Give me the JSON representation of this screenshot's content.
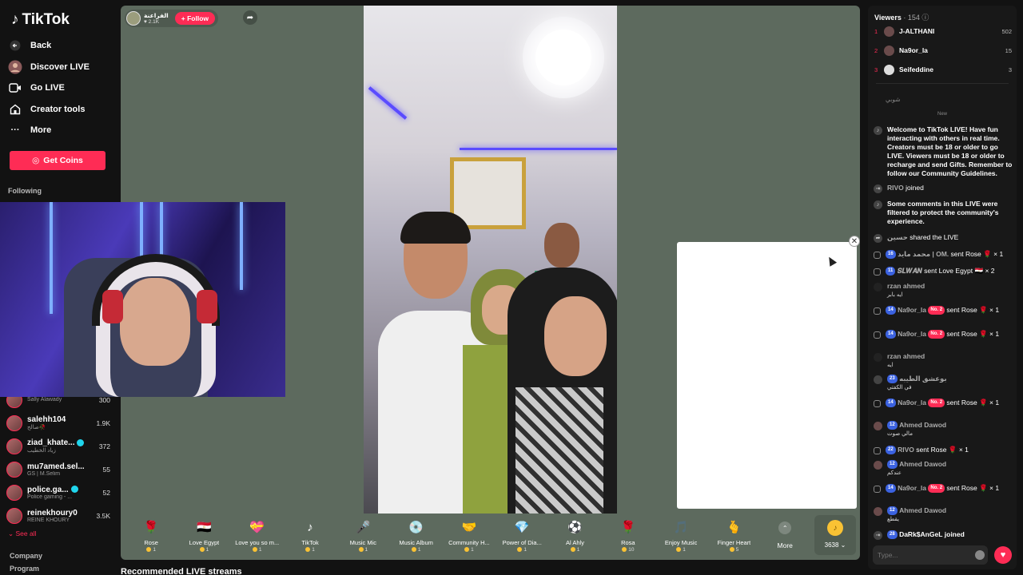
{
  "sidebar": {
    "logo": "TikTok",
    "nav": [
      {
        "label": "Back",
        "icon": "arrow-left-icon"
      },
      {
        "label": "Discover LIVE",
        "icon": "avatar-icon"
      },
      {
        "label": "Go LIVE",
        "icon": "camera-icon"
      },
      {
        "label": "Creator tools",
        "icon": "home-icon"
      },
      {
        "label": "More",
        "icon": "ellipsis-icon"
      }
    ],
    "get_coins": "Get Coins",
    "following_label": "Following",
    "following": [
      {
        "name": "",
        "sub": "Sally Alawady",
        "count": "300"
      },
      {
        "name": "salehh104",
        "sub": "صالح🥀",
        "count": "1.9K"
      },
      {
        "name": "ziad_khate...",
        "sub": "زياد الخطيب",
        "count": "372",
        "verified": true
      },
      {
        "name": "mu7amed.sel...",
        "sub": "GS | M.Selim",
        "count": "55"
      },
      {
        "name": "police.ga...",
        "sub": "Police gaming - ...",
        "count": "52",
        "verified": true
      },
      {
        "name": "reinekhoury0",
        "sub": "REINE KHOURY",
        "count": "3.5K"
      }
    ],
    "see_all": "See all",
    "footer": [
      "Company",
      "Program"
    ]
  },
  "stage": {
    "host_name": "الفراعنة",
    "host_likes": "2.1K",
    "follow_label": "+ Follow"
  },
  "gifts": [
    {
      "name": "Rose",
      "price": "1",
      "icon": "🌹"
    },
    {
      "name": "Love Egypt",
      "price": "1",
      "icon": "🇪🇬"
    },
    {
      "name": "Love you so m...",
      "price": "1",
      "icon": "💝"
    },
    {
      "name": "TikTok",
      "price": "1",
      "icon": "♪"
    },
    {
      "name": "Music Mic",
      "price": "1",
      "icon": "🎤"
    },
    {
      "name": "Music Album",
      "price": "1",
      "icon": "💿"
    },
    {
      "name": "Community H...",
      "price": "1",
      "icon": "🤝"
    },
    {
      "name": "Power of Dia...",
      "price": "1",
      "icon": "💎"
    },
    {
      "name": "Al Ahly",
      "price": "1",
      "icon": "⚽"
    },
    {
      "name": "Rosa",
      "price": "10",
      "icon": "🌹"
    },
    {
      "name": "Enjoy Music",
      "price": "1",
      "icon": "🎵"
    },
    {
      "name": "Finger Heart",
      "price": "5",
      "icon": "🫰"
    }
  ],
  "more_label": "More",
  "coin_balance": "3638",
  "recommended_title": "Recommended LIVE streams",
  "chat": {
    "viewers_label": "Viewers",
    "viewers_count": "· 154",
    "top_viewers": [
      {
        "rank": "1",
        "name": "J-ALTHANI",
        "score": "502"
      },
      {
        "rank": "2",
        "name": "Na9or_la",
        "score": "15"
      },
      {
        "rank": "3",
        "name": "Seifeddine",
        "score": "3"
      }
    ],
    "muted_msg": "شوبي",
    "new_divider": "New",
    "messages": [
      {
        "type": "sys",
        "text": "Welcome to TikTok LIVE! Have fun interacting with others in real time. Creators must be 18 or older to go LIVE. Viewers must be 18 or older to recharge and send Gifts. Remember to follow our Community Guidelines."
      },
      {
        "type": "join",
        "user": "RIVO",
        "text": "joined"
      },
      {
        "type": "sys",
        "text": "Some comments in this LIVE were filtered to protect the community's experience."
      },
      {
        "type": "share",
        "user": "حسين",
        "text": "shared the LIVE"
      },
      {
        "type": "gift",
        "level": "16",
        "user": "محمد مايد | OM.",
        "text": "sent Rose",
        "gift": "🌹",
        "qty": "× 1"
      },
      {
        "type": "gift",
        "level": "11",
        "user": "𝑺𝑳𝑾𝑨𝑵",
        "text": "sent Love Egypt",
        "gift": "🇪🇬",
        "qty": "× 2"
      },
      {
        "type": "comment",
        "user": "rzan ahmed",
        "text": "ايه بابر"
      },
      {
        "type": "gift",
        "level": "14",
        "user": "Na9or_la",
        "badge": "No. 2",
        "text": "sent Rose",
        "gift": "🌹",
        "qty": "× 1"
      },
      {
        "type": "gift",
        "level": "14",
        "user": "Na9or_la",
        "badge": "No. 2",
        "text": "sent Rose",
        "gift": "🌹",
        "qty": "× 1"
      },
      {
        "type": "comment",
        "user": "rzan ahmed",
        "text": "ايه"
      },
      {
        "type": "comment",
        "level": "23",
        "user": "بوعشق الطيبه",
        "text": "في الكفتي"
      },
      {
        "type": "gift",
        "level": "14",
        "user": "Na9or_la",
        "badge": "No. 2",
        "text": "sent Rose",
        "gift": "🌹",
        "qty": "× 1"
      },
      {
        "type": "comment",
        "level": "12",
        "user": "Ahmed Dawod",
        "text": "مالي صوت"
      },
      {
        "type": "gift",
        "level": "22",
        "user": "RIVO",
        "text": "sent Rose",
        "gift": "🌹",
        "qty": "× 1"
      },
      {
        "type": "comment",
        "level": "12",
        "user": "Ahmed Dawod",
        "text": "عندكم"
      },
      {
        "type": "gift",
        "level": "14",
        "user": "Na9or_la",
        "badge": "No. 2",
        "text": "sent Rose",
        "gift": "🌹",
        "qty": "× 1"
      },
      {
        "type": "comment",
        "level": "12",
        "user": "Ahmed Dawod",
        "text": "يقطع"
      },
      {
        "type": "join",
        "level": "28",
        "user": "DaRk$AnGeL",
        "text": "joined"
      }
    ],
    "input_placeholder": "Type..."
  }
}
